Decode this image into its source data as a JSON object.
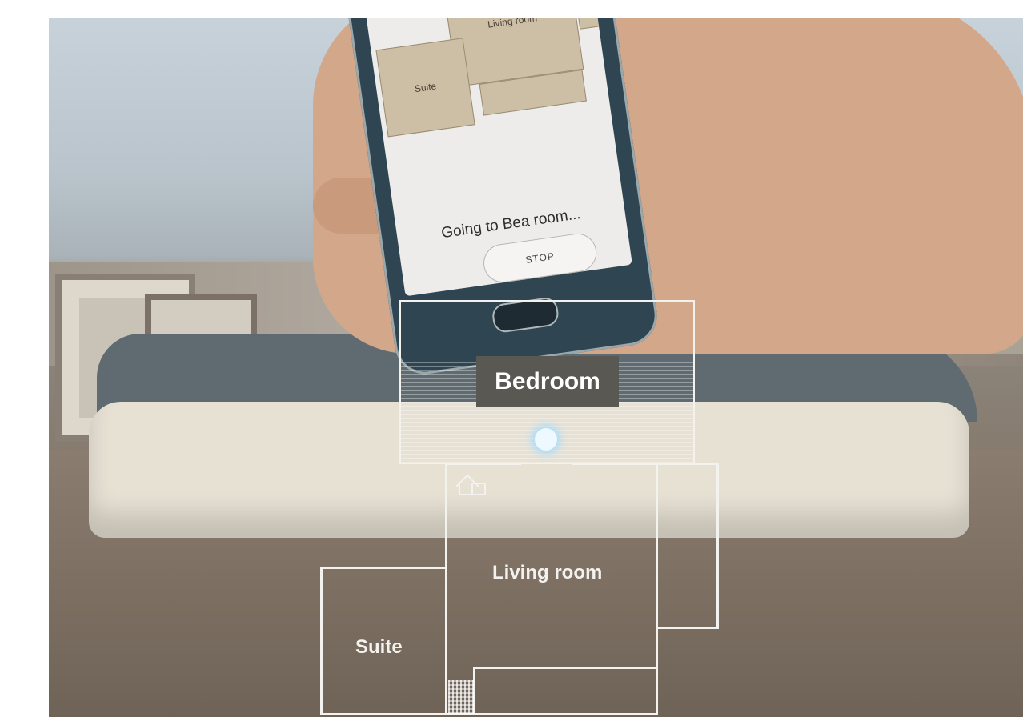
{
  "phone": {
    "rooms": [
      "Living room",
      "Suite"
    ],
    "status_text": "Going to Bea room...",
    "stop_label": "STOP"
  },
  "floor_plan": {
    "active_room": "Bedroom",
    "rooms": {
      "living": "Living room",
      "suite": "Suite"
    }
  },
  "icons": {
    "home": "home-icon",
    "robot": "robot-location-icon"
  }
}
